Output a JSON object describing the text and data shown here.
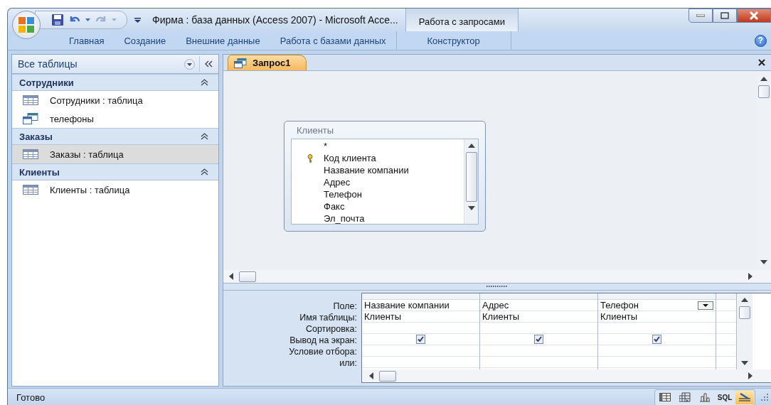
{
  "window": {
    "title": "Фирма : база данных (Access 2007) - Microsoft Acce...",
    "context_group": "Работа с запросами"
  },
  "help_button": {
    "label": "?"
  },
  "ribbon_tabs": [
    {
      "label": "Главная",
      "kind": "standard"
    },
    {
      "label": "Создание",
      "kind": "standard"
    },
    {
      "label": "Внешние данные",
      "kind": "standard"
    },
    {
      "label": "Работа с базами данных",
      "kind": "standard"
    },
    {
      "label": "Конструктор",
      "kind": "contextual"
    }
  ],
  "nav_pane": {
    "title": "Все таблицы",
    "groups": [
      {
        "name": "Сотрудники",
        "expanded": true,
        "items": [
          {
            "label": "Сотрудники : таблица",
            "kind": "table",
            "selected": false
          },
          {
            "label": "телефоны",
            "kind": "query",
            "selected": false
          }
        ]
      },
      {
        "name": "Заказы",
        "expanded": true,
        "items": [
          {
            "label": "Заказы : таблица",
            "kind": "table",
            "selected": true
          }
        ]
      },
      {
        "name": "Клиенты",
        "expanded": true,
        "items": [
          {
            "label": "Клиенты : таблица",
            "kind": "table",
            "selected": false
          }
        ]
      }
    ]
  },
  "document_tabs": [
    {
      "label": "Запрос1",
      "selected": true
    }
  ],
  "table_box": {
    "title": "Клиенты",
    "fields": [
      {
        "label": "*",
        "primary_key": false
      },
      {
        "label": "Код клиента",
        "primary_key": true
      },
      {
        "label": "Название компании",
        "primary_key": false
      },
      {
        "label": "Адрес",
        "primary_key": false
      },
      {
        "label": "Телефон",
        "primary_key": false
      },
      {
        "label": "Факс",
        "primary_key": false
      },
      {
        "label": "Эл_почта",
        "primary_key": false
      }
    ]
  },
  "design_grid": {
    "row_labels": [
      "Поле:",
      "Имя таблицы:",
      "Сортировка:",
      "Вывод на экран:",
      "Условие отбора:",
      "или:"
    ],
    "columns": [
      {
        "field": "Название компании",
        "table": "Клиенты",
        "show": true,
        "dropdown": false
      },
      {
        "field": "Адрес",
        "table": "Клиенты",
        "show": true,
        "dropdown": false
      },
      {
        "field": "Телефон",
        "table": "Клиенты",
        "show": true,
        "dropdown": true
      }
    ]
  },
  "status_bar": {
    "text": "Готово",
    "views": [
      {
        "kind": "datasheet",
        "selected": false
      },
      {
        "kind": "pivot_table",
        "selected": false
      },
      {
        "kind": "pivot_chart",
        "selected": false
      },
      {
        "kind": "sql",
        "label": "SQL",
        "selected": false
      },
      {
        "kind": "design",
        "selected": true
      }
    ]
  }
}
